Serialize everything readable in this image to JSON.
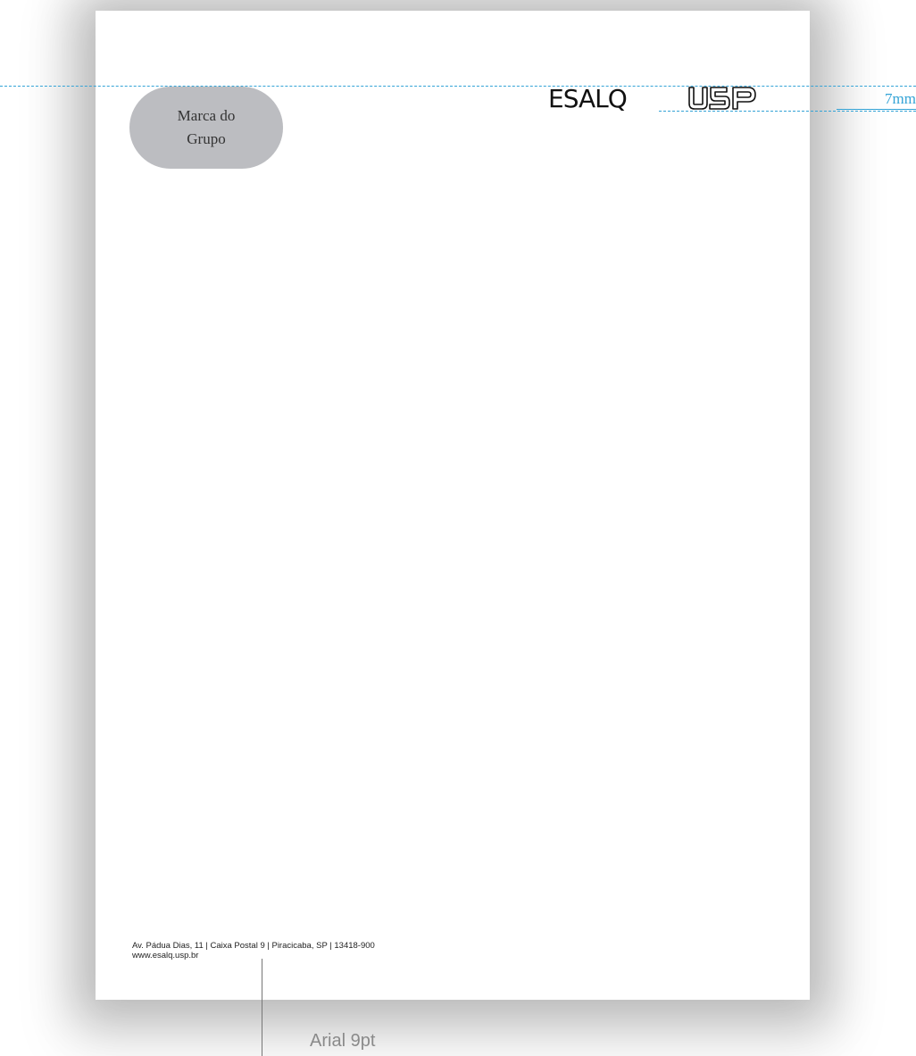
{
  "group_mark": {
    "line1": "Marca do",
    "line2": "Grupo",
    "color": "#bcbdc1"
  },
  "logos": {
    "esalq": "ESALQ",
    "usp": "USP"
  },
  "guide": {
    "measure_label": "7mm",
    "color": "#33a3d6"
  },
  "footer": {
    "address": "Av. Pádua Dias, 11 | Caixa Postal 9 | Piracicaba, SP | 13418-900",
    "url": "www.esalq.usp.br"
  },
  "annotation": {
    "font_spec": "Arial 9pt"
  }
}
